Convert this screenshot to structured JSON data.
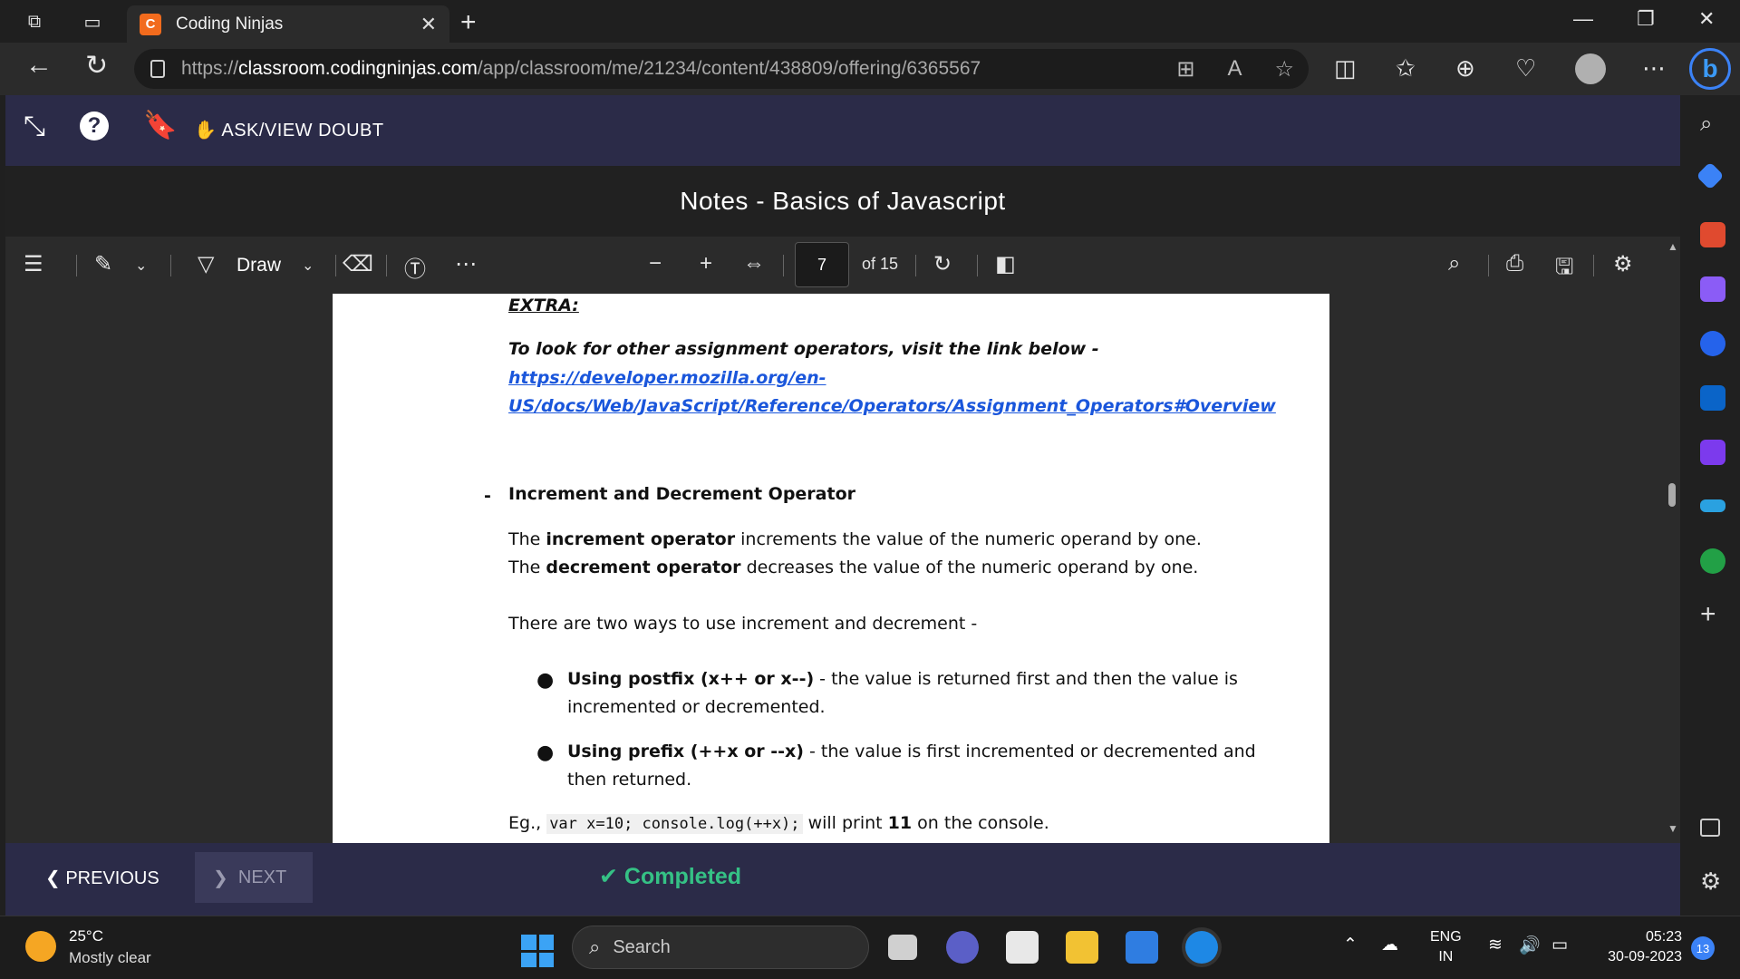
{
  "browser": {
    "tab_title": "Coding Ninjas",
    "tab_favicon": "C",
    "url_prefix": "https://",
    "url_host": "classroom.codingninjas.com",
    "url_path": "/app/classroom/me/21234/content/438809/offering/6365567"
  },
  "app": {
    "ask_label": "ASK/VIEW DOUBT",
    "doc_title": "Notes - Basics of Javascript",
    "help_glyph": "?"
  },
  "pdf": {
    "draw_label": "Draw",
    "page_current": "7",
    "page_total_label": "of 15"
  },
  "content": {
    "extra": "EXTRA:",
    "look": "To look for other assignment operators, visit the link below -",
    "link_line1": "https://developer.mozilla.org/en-",
    "link_line2": "US/docs/Web/JavaScript/Reference/Operators/Assignment_Operators#Overview",
    "dash": "-",
    "heading": "Increment and Decrement Operator",
    "inc_pre": "The ",
    "inc_bold": "increment operator",
    "inc_post": " increments the value of the numeric operand by one.",
    "dec_pre": "The ",
    "dec_bold": "decrement operator",
    "dec_post": " decreases the value of the numeric operand by one.",
    "two_ways": "There are two ways to use increment and decrement -",
    "bullet_glyph": "●",
    "postfix_bold": "Using postfix (x++ or x--)",
    "postfix_text": " - the value is returned first and then the value is incremented or decremented.",
    "prefix_bold": "Using prefix (++x or --x)",
    "prefix_text": " - the value is first incremented or decremented and then returned.",
    "eg_pre": "Eg., ",
    "eg_code": "var x=10; console.log(++x);",
    "eg_mid": " will print ",
    "eg_bold": "11",
    "eg_post": " on the console."
  },
  "footer": {
    "previous": "PREVIOUS",
    "next": "NEXT",
    "completed": "Completed"
  },
  "taskbar": {
    "temp": "25°C",
    "weather": "Mostly clear",
    "search": "Search",
    "lang1": "ENG",
    "lang2": "IN",
    "time": "05:23",
    "date": "30-09-2023",
    "notif_count": "13"
  }
}
